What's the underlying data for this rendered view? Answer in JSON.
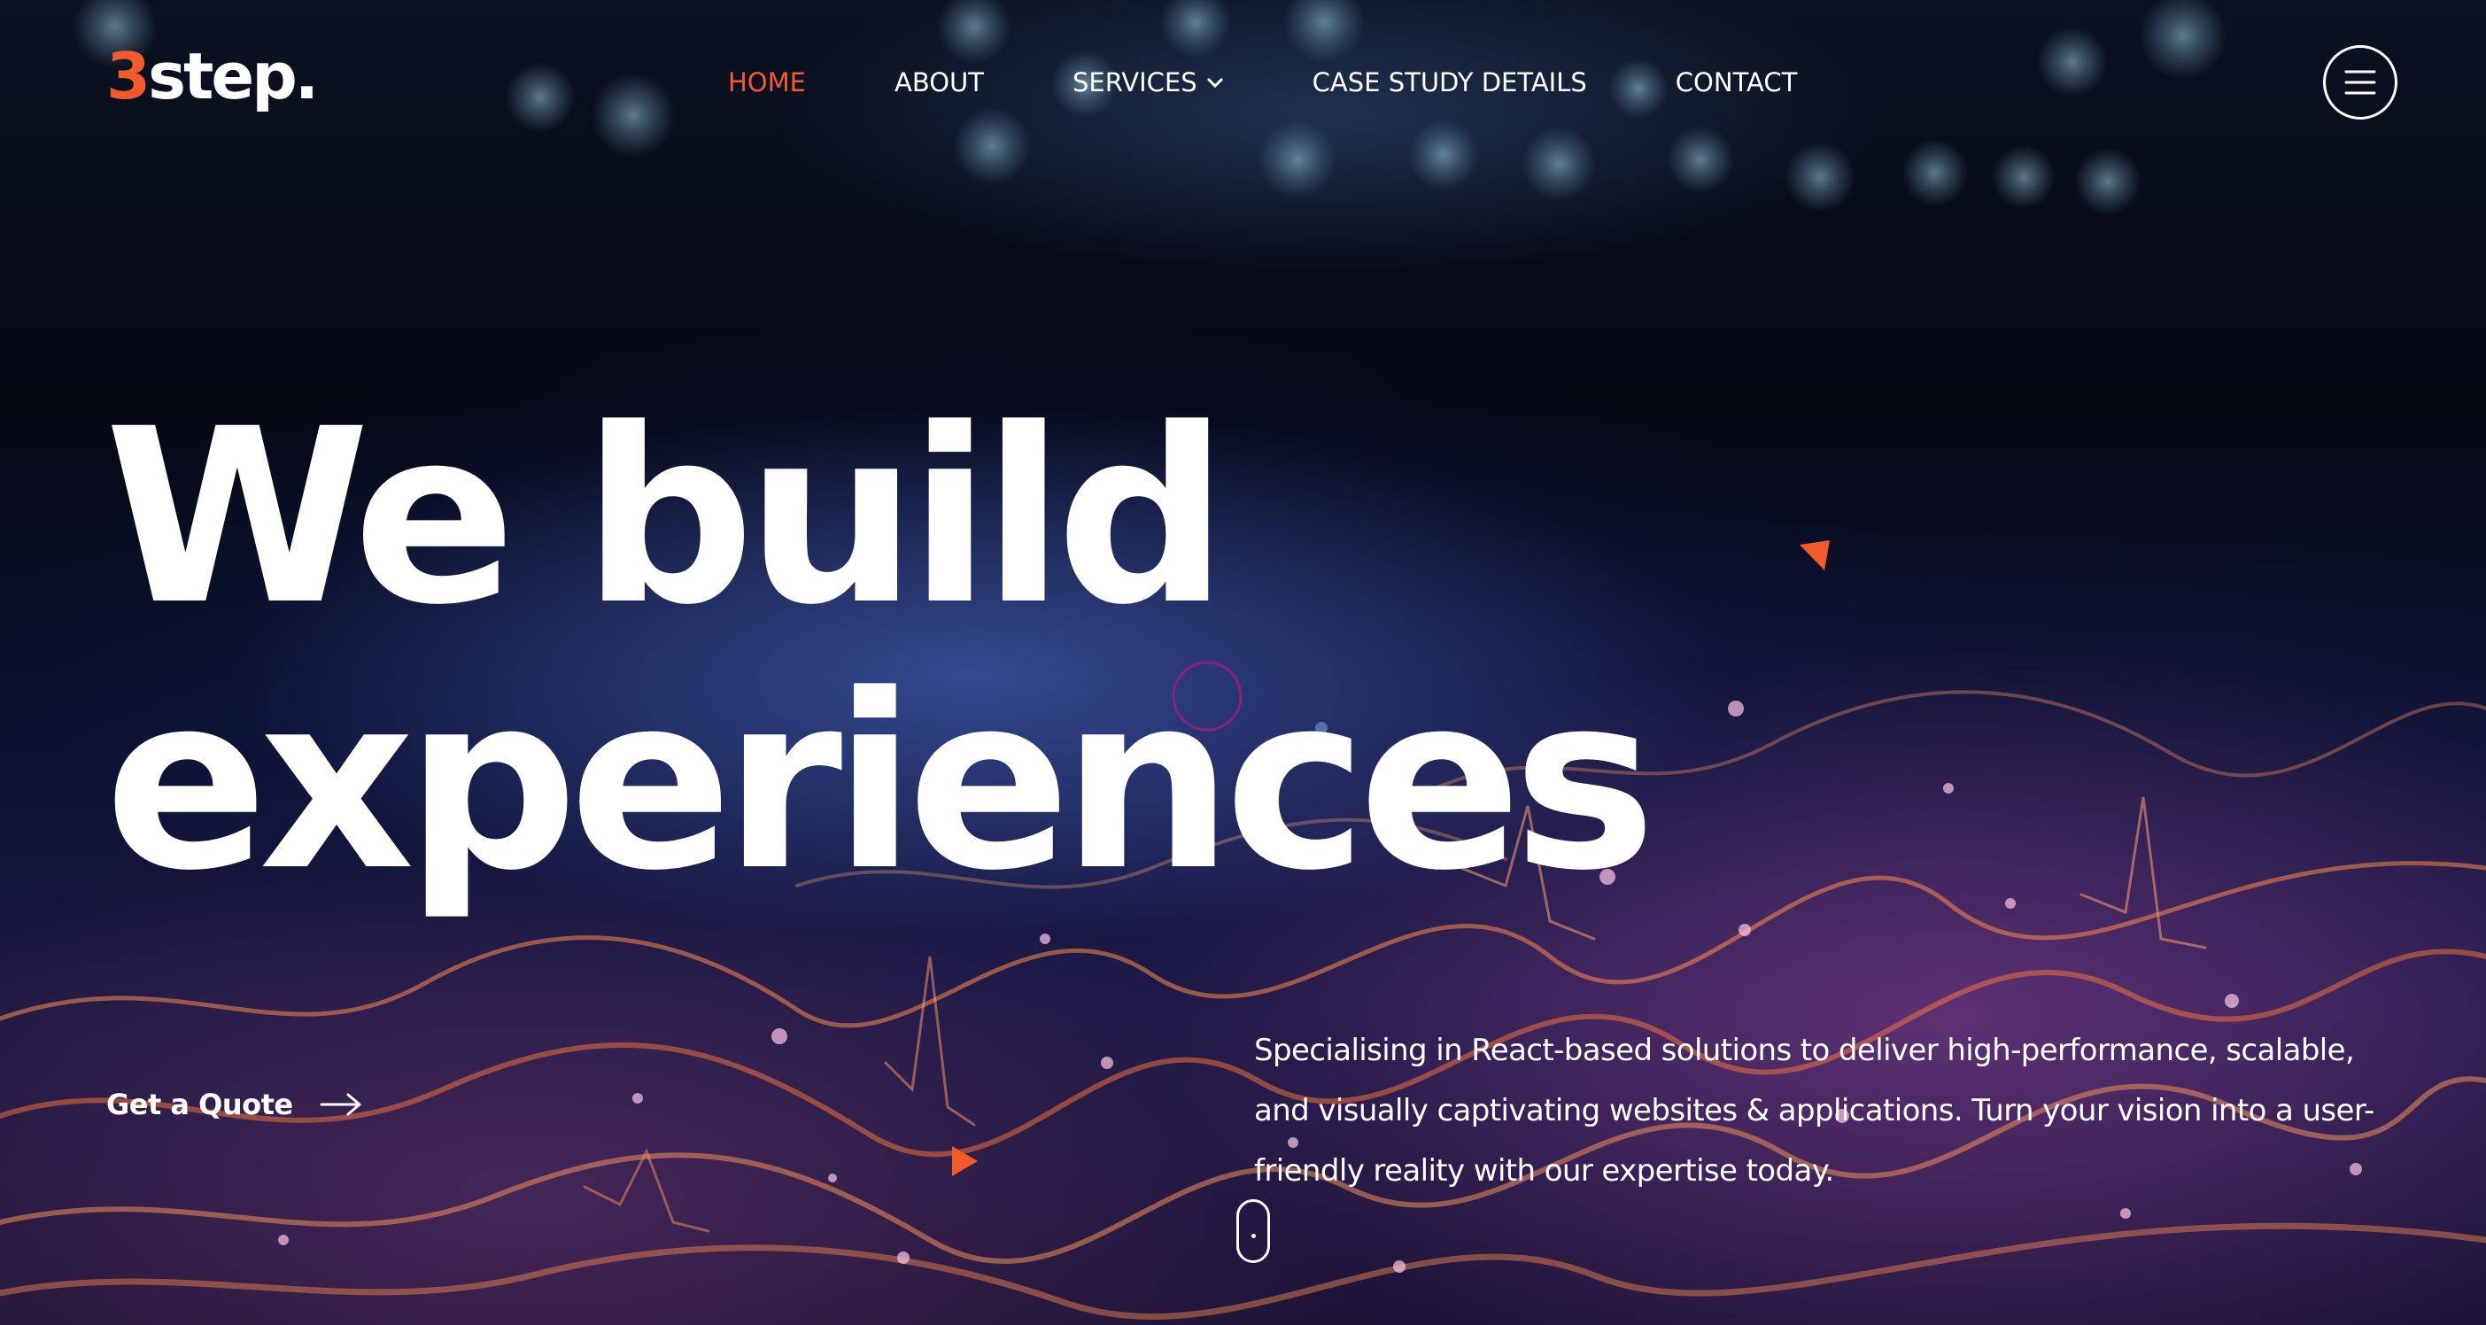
{
  "brand": {
    "logo_digit": "3",
    "logo_text": "step."
  },
  "nav": {
    "items": [
      {
        "label": "HOME",
        "active": true
      },
      {
        "label": "ABOUT"
      },
      {
        "label": "SERVICES",
        "has_dropdown": true
      },
      {
        "label": "CASE STUDY DETAILS"
      },
      {
        "label": "CONTACT"
      }
    ],
    "menu_icon": "hamburger-menu-icon"
  },
  "hero": {
    "headline_line1": "We build",
    "headline_line2": "experiences",
    "cta_label": "Get a Quote",
    "cta_icon": "arrow-right-icon",
    "description": "Specialising in React-based solutions to deliver high-performance, scalable, and visually captivating websites & applications. Turn your vision into a user-friendly reality with our expertise today."
  },
  "colors": {
    "accent": "#f15a2b",
    "text": "#ffffff",
    "background": "#05060f"
  }
}
